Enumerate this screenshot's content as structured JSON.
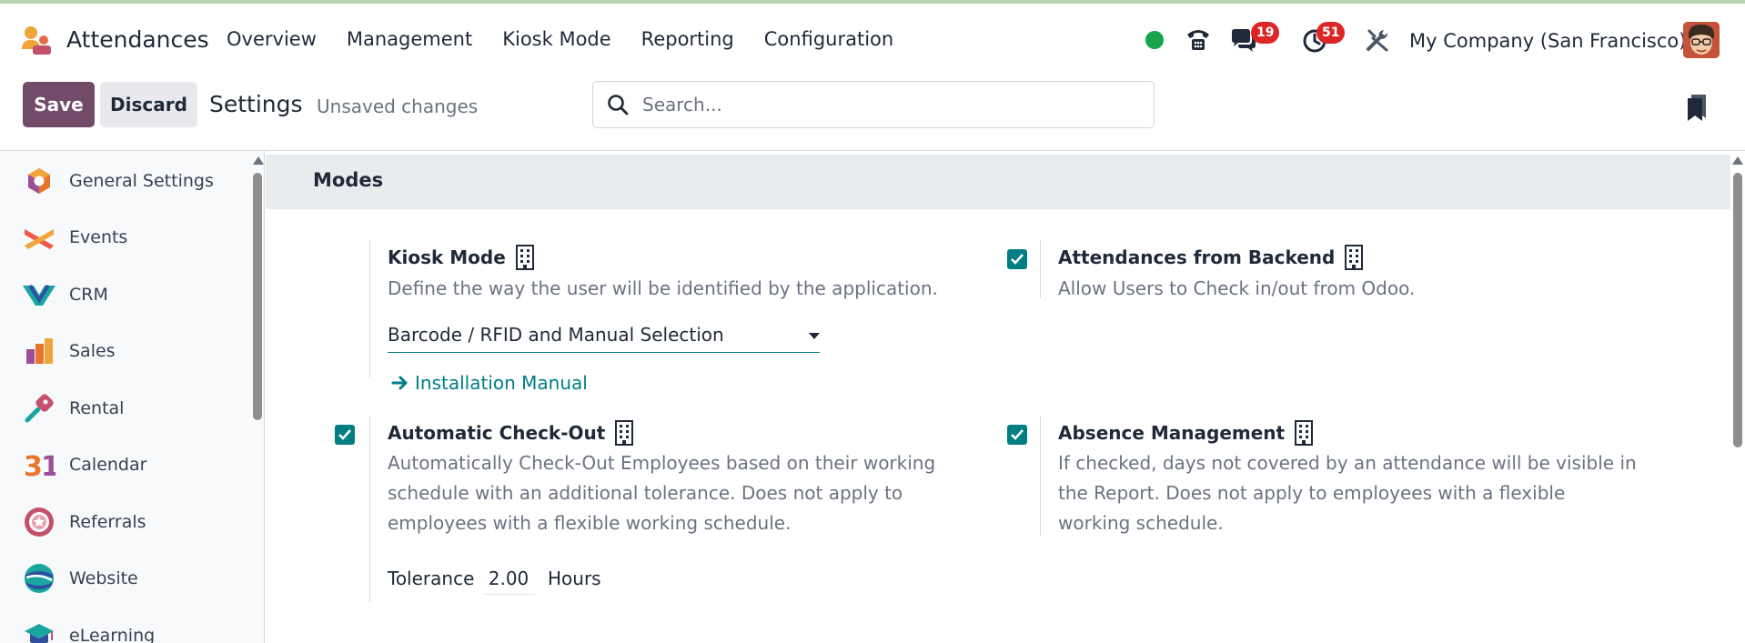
{
  "navbar": {
    "app_name": "Attendances",
    "menu": [
      "Overview",
      "Management",
      "Kiosk Mode",
      "Reporting",
      "Configuration"
    ],
    "messages_count": "19",
    "activities_count": "51",
    "company": "My Company (San Francisco)"
  },
  "control_panel": {
    "save_label": "Save",
    "discard_label": "Discard",
    "title": "Settings",
    "status": "Unsaved changes",
    "search_placeholder": "Search..."
  },
  "sidebar": {
    "items": [
      {
        "label": "General Settings",
        "icon": "general-settings-icon"
      },
      {
        "label": "Events",
        "icon": "events-icon"
      },
      {
        "label": "CRM",
        "icon": "crm-icon"
      },
      {
        "label": "Sales",
        "icon": "sales-icon"
      },
      {
        "label": "Rental",
        "icon": "rental-icon"
      },
      {
        "label": "Calendar",
        "icon": "calendar-icon"
      },
      {
        "label": "Referrals",
        "icon": "referrals-icon"
      },
      {
        "label": "Website",
        "icon": "website-icon"
      },
      {
        "label": "eLearning",
        "icon": "elearning-icon"
      }
    ]
  },
  "section": {
    "title": "Modes",
    "kiosk": {
      "title": "Kiosk Mode",
      "description": "Define the way the user will be identified by the application.",
      "selected": "Barcode / RFID and Manual Selection",
      "link": "Installation Manual"
    },
    "backend": {
      "title": "Attendances from Backend",
      "description": "Allow Users to Check in/out from Odoo.",
      "checked": true
    },
    "checkout": {
      "title": "Automatic Check-Out",
      "description": "Automatically Check-Out Employees based on their working schedule with an additional tolerance. Does not apply to employees with a flexible working schedule.",
      "checked": true,
      "tolerance_label": "Tolerance",
      "tolerance_value": "2.00",
      "tolerance_unit": "Hours"
    },
    "absence": {
      "title": "Absence Management",
      "description": "If checked, days not covered by an attendance will be visible in the Report. Does not apply to employees with a flexible working schedule.",
      "checked": true
    }
  },
  "colors": {
    "primary": "#714b67",
    "accent": "#017e84",
    "badge": "#dc2626",
    "online": "#16a34a"
  }
}
